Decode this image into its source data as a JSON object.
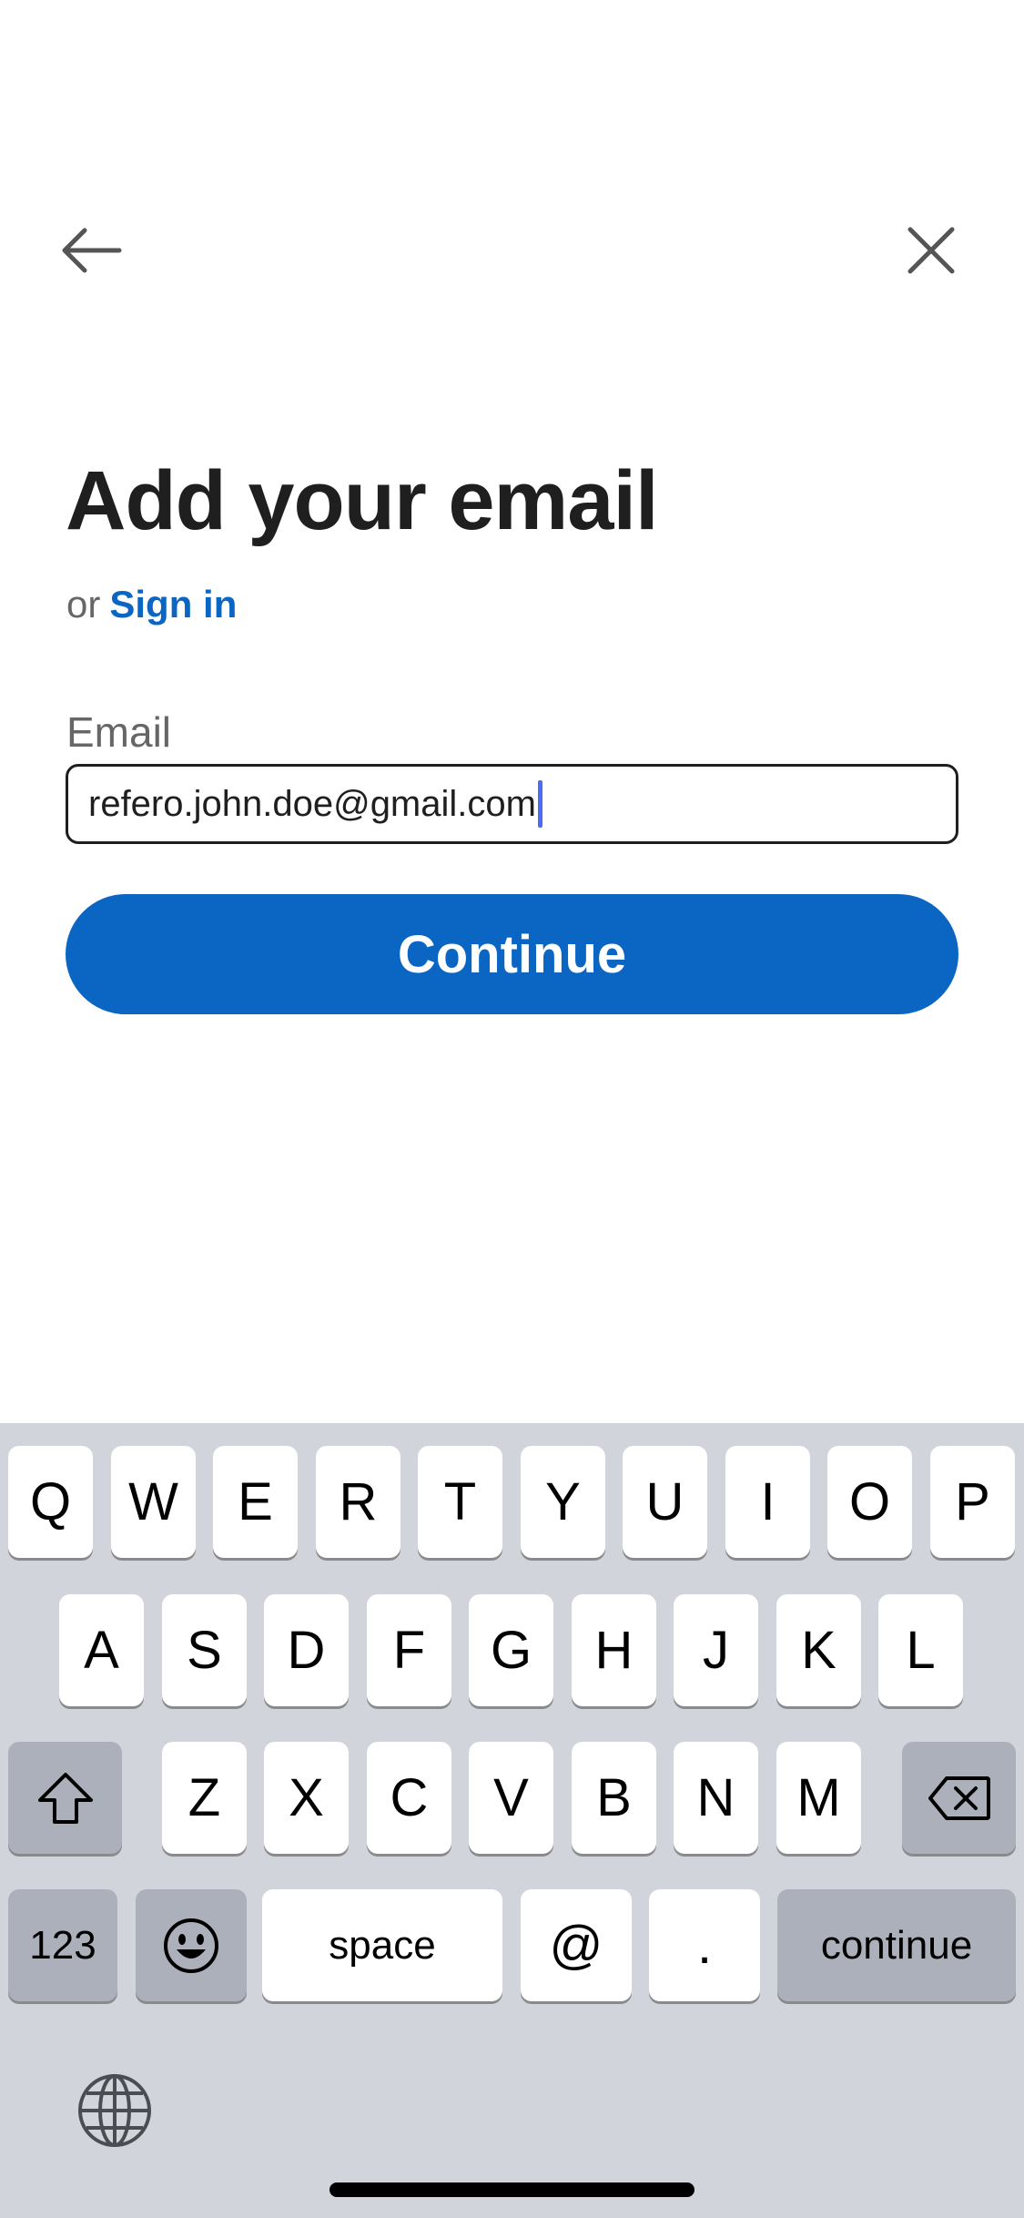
{
  "header": {
    "back_icon": "arrow-left-icon",
    "close_icon": "close-icon"
  },
  "page": {
    "title": "Add your email",
    "alt_prefix": "or",
    "sign_in_link": "Sign in",
    "accent": "#0a66c2"
  },
  "form": {
    "email_label": "Email",
    "email_value": "refero.john.doe@gmail.com",
    "continue_label": "Continue"
  },
  "keyboard": {
    "row1": [
      "Q",
      "W",
      "E",
      "R",
      "T",
      "Y",
      "U",
      "I",
      "O",
      "P"
    ],
    "row2": [
      "A",
      "S",
      "D",
      "F",
      "G",
      "H",
      "J",
      "K",
      "L"
    ],
    "row3": [
      "Z",
      "X",
      "C",
      "V",
      "B",
      "N",
      "M"
    ],
    "shift_icon": "shift-icon",
    "delete_icon": "backspace-icon",
    "numbers_label": "123",
    "emoji_icon": "emoji-icon",
    "space_label": "space",
    "at_label": "@",
    "dot_label": ".",
    "return_label": "continue",
    "globe_icon": "globe-icon"
  }
}
